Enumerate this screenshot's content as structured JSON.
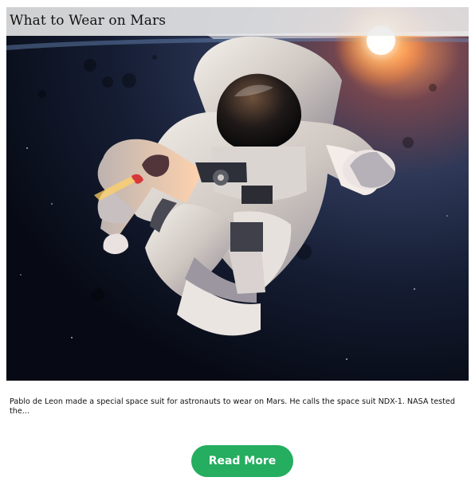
{
  "article": {
    "title": "What to Wear on Mars",
    "image": "astronaut floating in space with sunrise over Earth",
    "excerpt": "Pablo de Leon made a special space suit for astronauts to wear on Mars. He calls the space suit NDX-1. NASA tested the...",
    "button_label": "Read More"
  },
  "colors": {
    "button": "#25ad60",
    "title_bar": "#ececec",
    "text": "#111111"
  }
}
